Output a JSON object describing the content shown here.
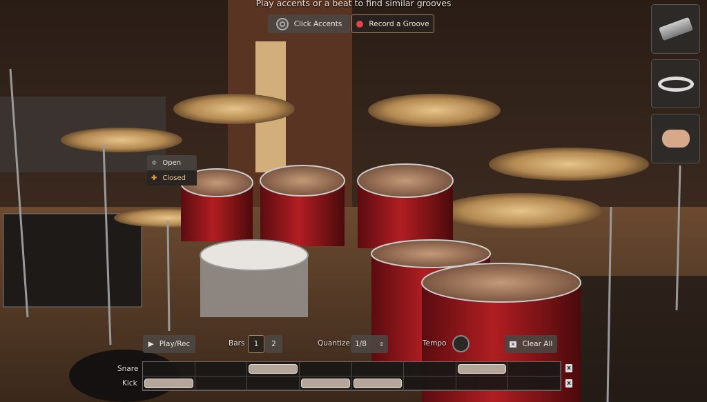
{
  "header": {
    "hint": "Play accents or a beat to find similar grooves",
    "click_accents": "Click Accents",
    "record_groove": "Record a Groove"
  },
  "side_panel": [
    {
      "name": "ezd-device"
    },
    {
      "name": "tambourine"
    },
    {
      "name": "hand-clap"
    }
  ],
  "hihat_popup": {
    "items": [
      {
        "label": "Open",
        "selected": false
      },
      {
        "label": "Closed",
        "selected": true
      }
    ]
  },
  "controls": {
    "play_rec": "Play/Rec",
    "bars_label": "Bars",
    "bars": [
      "1",
      "2"
    ],
    "bars_selected": "1",
    "quantize_label": "Quantize",
    "quantize_value": "1/8",
    "tempo_label": "Tempo",
    "clear_all": "Clear All"
  },
  "grid": {
    "steps": 8,
    "rows": [
      {
        "label": "Snare",
        "hits": [
          3,
          7
        ]
      },
      {
        "label": "Kick",
        "hits": [
          1,
          4,
          5
        ]
      }
    ]
  },
  "colors": {
    "accent": "#a4845a",
    "record": "#e0444a",
    "selected_text": "#f0c489"
  }
}
